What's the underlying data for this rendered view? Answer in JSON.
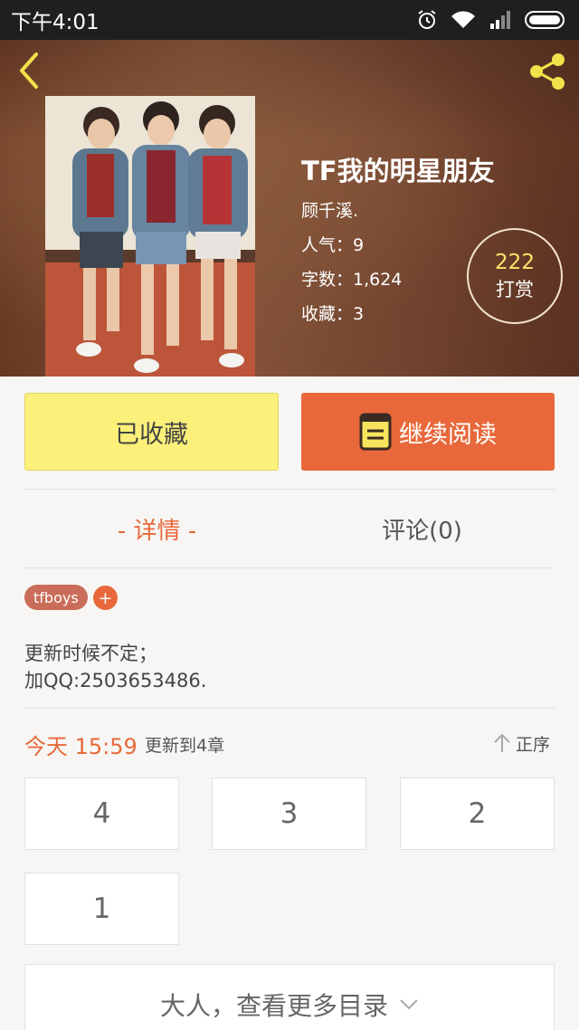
{
  "status_bar": {
    "time": "下午4:01"
  },
  "book": {
    "title": "TF我的明星朋友",
    "author": "顾千溪.",
    "popularity": "人气：9",
    "word_count": "字数：1,624",
    "favorites": "收藏：3",
    "tip_count": "222",
    "tip_label": "打赏"
  },
  "actions": {
    "collected_label": "已收藏",
    "read_label": "继续阅读"
  },
  "tabs": {
    "detail": "- 详情 -",
    "comments": "评论(0)"
  },
  "tags": {
    "items": [
      "tfboys"
    ],
    "add": "+"
  },
  "description": {
    "line1": "更新时候不定；",
    "line2": "加QQ:2503653486."
  },
  "update": {
    "time": "今天 15:59",
    "text": "更新到4章",
    "sort_label": "正序"
  },
  "chapters": [
    "4",
    "3",
    "2",
    "1"
  ],
  "more_catalog": "大人，查看更多目录",
  "colors": {
    "accent": "#e8683b",
    "collected_bg": "#fbf17a",
    "tip_count": "#ffe36a",
    "tag": "#c96d5a"
  }
}
